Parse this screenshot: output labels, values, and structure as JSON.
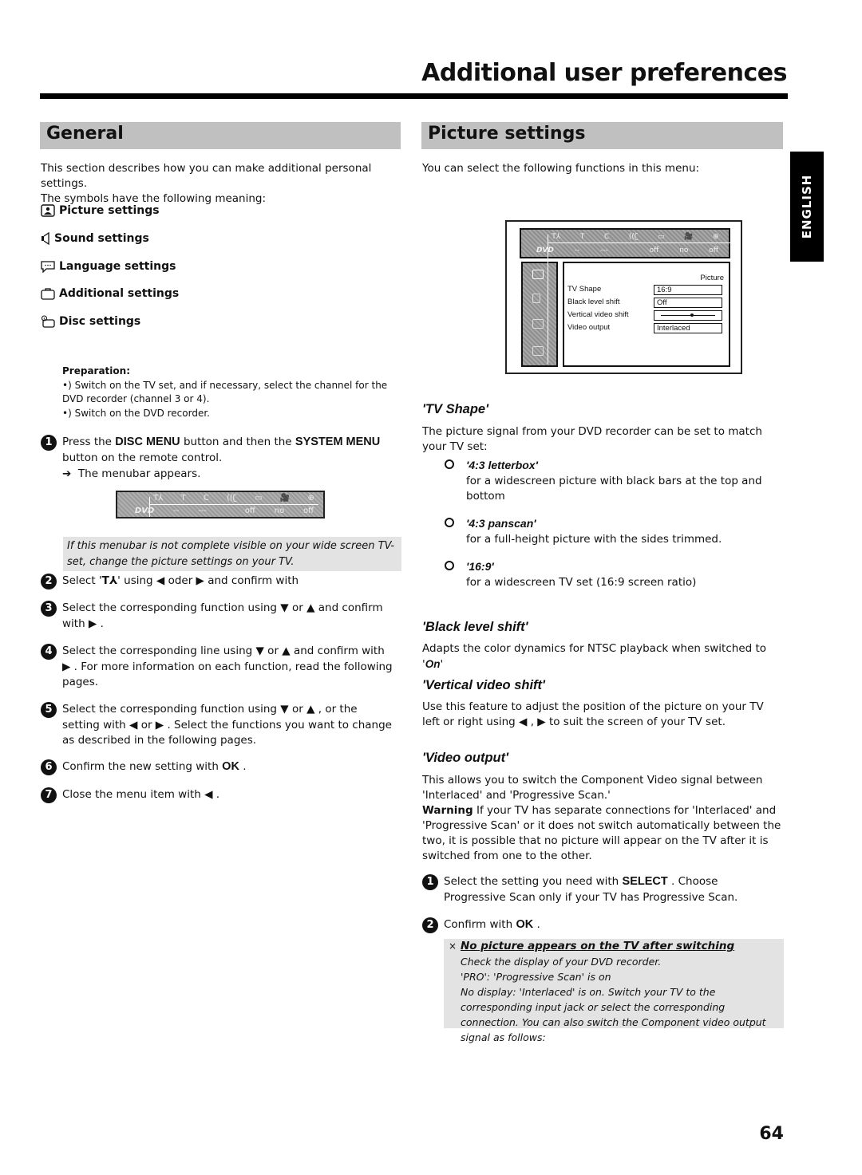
{
  "header": {
    "title": "Additional user preferences"
  },
  "language_tab": "ENGLISH",
  "page_number": "64",
  "general": {
    "heading": "General",
    "intro_lines": [
      "This section describes how you can make additional personal settings.",
      "The symbols have the following meaning:"
    ],
    "symbols": [
      {
        "icon": "picture-icon",
        "label": "Picture settings"
      },
      {
        "icon": "speaker-icon",
        "label": "Sound settings"
      },
      {
        "icon": "speech-bubble-icon",
        "label": "Language settings"
      },
      {
        "icon": "briefcase-icon",
        "label": "Additional settings"
      },
      {
        "icon": "disc-tray-icon",
        "label": "Disc settings"
      }
    ],
    "preparation": {
      "title": "Preparation:",
      "lines": [
        "•) Switch on the TV set, and if necessary, select the channel for the DVD recorder (channel 3 or 4).",
        "•) Switch on the DVD recorder."
      ]
    },
    "steps": [
      {
        "num": "1",
        "pre": "Press the ",
        "key1": "DISC MENU",
        "mid": " button and then the ",
        "key2": "SYSTEM MENU",
        "post": " button on the remote control.",
        "result": "The menubar appears."
      },
      {
        "num": "2",
        "pre": "Select '",
        "symbol": "T⅄",
        "post": "' using ◀ oder ▶ and confirm with"
      },
      {
        "num": "3",
        "text": "Select the corresponding function using ▼ or ▲ and confirm with ▶ ."
      },
      {
        "num": "4",
        "text": "Select the corresponding line using ▼ or ▲ and confirm with ▶ . For more information on each function, read the following pages."
      },
      {
        "num": "5",
        "text": "Select the corresponding function using ▼ or ▲ , or the setting with ◀ or ▶ . Select the functions you want to change as described in the following pages."
      },
      {
        "num": "6",
        "pre": "Confirm the new setting with ",
        "key1": "OK",
        "post": " ."
      },
      {
        "num": "7",
        "text": "Close the menu item with ◀ ."
      }
    ],
    "menubar_note": "If this menubar is not complete visible on your wide screen TV-set, change the picture settings on your TV.",
    "menubar": {
      "icons": [
        "T⅄",
        "T",
        "C",
        "((ʗ",
        "▭",
        "🎥",
        "⊕"
      ],
      "values": [
        "DVD",
        "--",
        "---",
        "",
        "off",
        "no",
        "off"
      ]
    }
  },
  "picture": {
    "heading": "Picture settings",
    "intro": "You can select the following functions in this menu:",
    "screen": {
      "panel_title": "Picture",
      "rows": [
        {
          "label": "TV Shape",
          "value": "16:9"
        },
        {
          "label": "Black level shift",
          "value": "Off"
        },
        {
          "label": "Vertical video shift",
          "value": "",
          "slider_fraction": 0.58
        },
        {
          "label": "Video output",
          "value": "Interlaced"
        }
      ]
    },
    "tv_shape": {
      "heading": "'TV Shape'",
      "desc": "The picture signal from your DVD recorder can be set to match your TV set:",
      "options": [
        {
          "name": "'4:3 letterbox'",
          "desc": "for a widescreen picture with black bars at the top and bottom"
        },
        {
          "name": "'4:3 panscan'",
          "desc": "for a full-height picture with the sides trimmed."
        },
        {
          "name": "'16:9'",
          "desc": "for a widescreen TV set (16:9 screen ratio)"
        }
      ]
    },
    "black_level": {
      "heading": "'Black level shift'",
      "desc_pre": "Adapts the color dynamics for NTSC playback when switched to '",
      "desc_em": "On",
      "desc_post": "'"
    },
    "vertical_shift": {
      "heading": "'Vertical video shift'",
      "desc": "Use this feature to adjust the position of the picture on your TV left or right using ◀ , ▶ to suit the screen of your TV set."
    },
    "video_output": {
      "heading": "'Video output'",
      "desc": "This allows you to switch the Component Video signal between 'Interlaced' and 'Progressive Scan.'",
      "warning_label": "Warning",
      "warning": " If your TV has separate connections for 'Interlaced' and 'Progressive Scan' or it does not switch automatically between the two, it is possible that no picture will appear on the TV after it is switched from one to the other.",
      "steps": [
        {
          "num": "1",
          "pre": "Select the setting you need with ",
          "key": "SELECT",
          "post": " . Choose Progressive Scan only if your TV has Progressive Scan."
        },
        {
          "num": "2",
          "pre": "Confirm with ",
          "key": "OK",
          "post": " ."
        }
      ],
      "troubleshoot": {
        "title": "No picture appears on the TV after switching",
        "lines": [
          "Check the display of your DVD recorder.",
          "'PRO': 'Progressive Scan' is on",
          "No display: 'Interlaced' is on. Switch your TV to the corresponding input jack or select the corresponding connection. You can also switch the Component video output signal as follows:"
        ]
      }
    }
  }
}
